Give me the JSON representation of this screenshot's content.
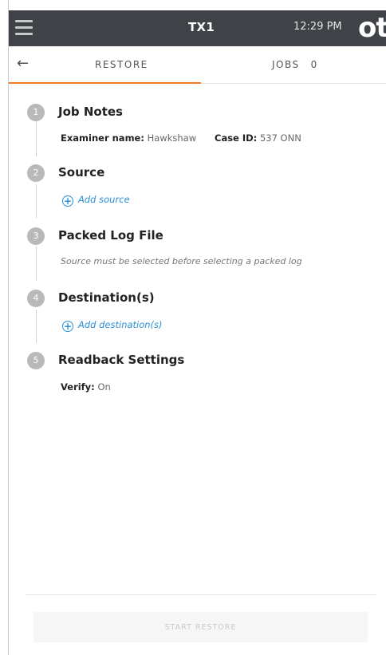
{
  "topbar": {
    "device": "TX1",
    "time": "12:29 PM",
    "logo_text": "ot"
  },
  "tabs": {
    "back_icon": "←",
    "restore": "RESTORE",
    "jobs": "JOBS",
    "jobs_count": "0"
  },
  "steps": [
    {
      "number": "1",
      "title": "Job Notes"
    },
    {
      "number": "2",
      "title": "Source"
    },
    {
      "number": "3",
      "title": "Packed Log File"
    },
    {
      "number": "4",
      "title": "Destination(s)"
    },
    {
      "number": "5",
      "title": "Readback Settings"
    }
  ],
  "job_notes": {
    "examiner_label": "Examiner name:",
    "examiner_value": "Hawkshaw",
    "case_label": "Case ID:",
    "case_value": "537 ONN"
  },
  "source": {
    "add_label": "Add source"
  },
  "packed_log": {
    "note": "Source must be selected before selecting a packed log"
  },
  "destination": {
    "add_label": "Add destination(s)"
  },
  "readback": {
    "verify_label": "Verify:",
    "verify_value": "On"
  },
  "footer": {
    "start_button": "START RESTORE"
  },
  "colors": {
    "accent": "#f07a22",
    "link": "#2b8fd6",
    "topbar": "#3f4246"
  }
}
